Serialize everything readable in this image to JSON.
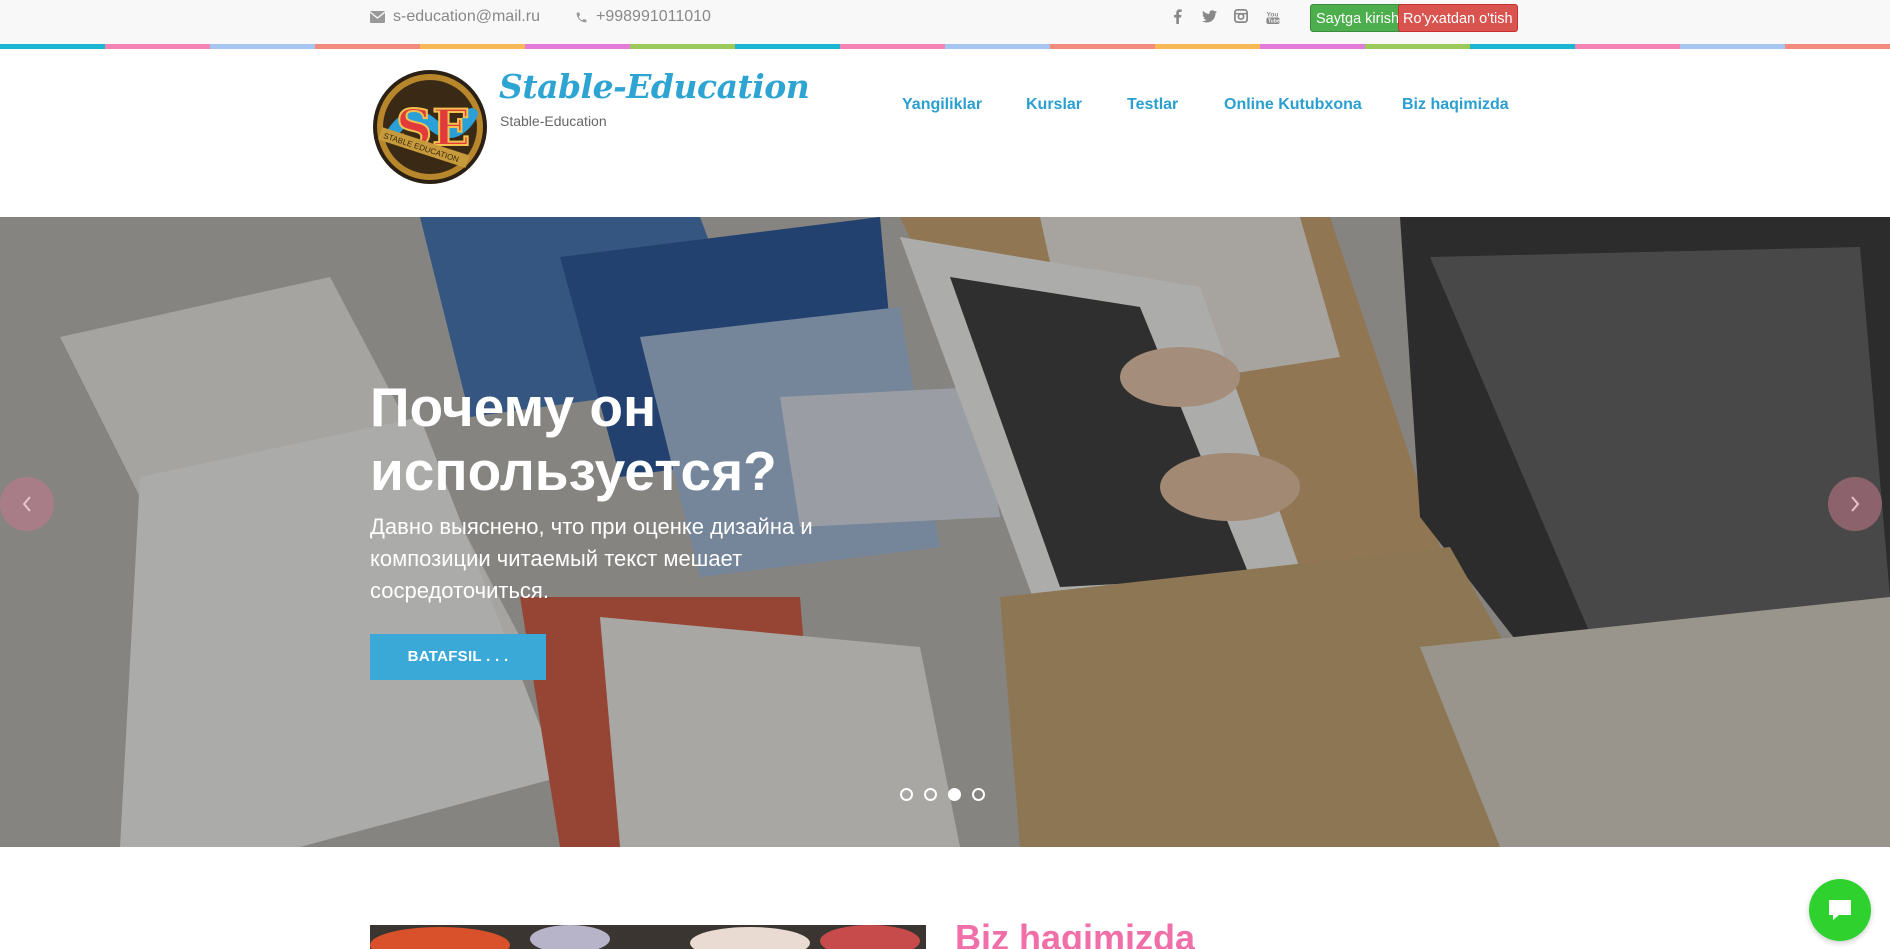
{
  "topbar": {
    "email": "s-education@mail.ru",
    "phone": "+998991011010",
    "socials": [
      "facebook-icon",
      "twitter-icon",
      "instagram-icon",
      "youtube-icon"
    ],
    "login_label": "Saytga kirish",
    "register_label": "Ro'yxatdan o'tish"
  },
  "header": {
    "brand_title": "Stable-Education",
    "brand_subtitle": "Stable-Education",
    "logo_letters": "SE",
    "logo_ribbon": "STABLE EDUCATION"
  },
  "nav": {
    "items": [
      {
        "label": "Yangiliklar"
      },
      {
        "label": "Kurslar"
      },
      {
        "label": "Testlar"
      },
      {
        "label": "Online Kutubxona"
      },
      {
        "label": "Biz haqimizda"
      }
    ]
  },
  "hero": {
    "title": "Почему он используется?",
    "text": "Давно выяснено, что при оценке дизайна и композиции читаемый текст мешает сосредоточиться.",
    "button_label": "BATAFSIL . . .",
    "slides": 4,
    "active_slide": 3
  },
  "about": {
    "title": "Biz haqimizda"
  },
  "colors": {
    "accent_blue": "#2ea4d3",
    "button_green": "#4cae4c",
    "button_red": "#d9534f",
    "about_pink": "#f06fa8",
    "chat_green": "#2fd12f",
    "strip": [
      "#1bb7d0",
      "#f383b3",
      "#a6c5f0",
      "#f38a7e",
      "#f7b955",
      "#e47bd9",
      "#9bc95a",
      "#1bb7d0",
      "#f383b3",
      "#a6c5f0",
      "#f38a7e",
      "#f7b955",
      "#e47bd9",
      "#9bc95a",
      "#1bb7d0",
      "#f383b3",
      "#a6c5f0",
      "#f38a7e"
    ]
  }
}
